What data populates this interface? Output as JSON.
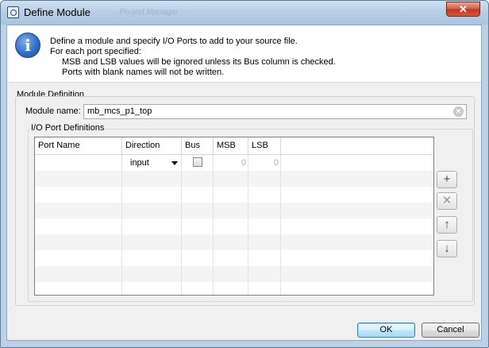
{
  "window": {
    "title": "Define Module",
    "background_title_ghost": "Project Manager",
    "close_glyph": "✕"
  },
  "header": {
    "icon": "info-icon",
    "line1": "Define a module and specify I/O Ports to add to your source file.",
    "line2": "For each port specified:",
    "line3": "MSB and LSB values will be ignored unless its Bus column is checked.",
    "line4": "Ports with blank names will not be written."
  },
  "module_definition": {
    "section_label": "Module Definition",
    "name_label": "Module name:",
    "name_value": "mb_mcs_p1_top"
  },
  "io_ports": {
    "label": "I/O Port Definitions",
    "columns": [
      "Port Name",
      "Direction",
      "Bus",
      "MSB",
      "LSB"
    ],
    "rows": [
      {
        "port_name": "",
        "direction": "input",
        "bus": false,
        "msb": "0",
        "lsb": "0"
      }
    ]
  },
  "side_buttons": [
    {
      "name": "add-port-button",
      "glyph": "+",
      "enabled": true
    },
    {
      "name": "remove-port-button",
      "glyph": "✕",
      "enabled": false
    },
    {
      "name": "move-up-button",
      "glyph": "↑",
      "enabled": true
    },
    {
      "name": "move-down-button",
      "glyph": "↓",
      "enabled": true
    }
  ],
  "footer": {
    "ok_label": "OK",
    "cancel_label": "Cancel"
  },
  "colors": {
    "titlebar": "#b9cfe8",
    "close_button": "#c2391f",
    "dialog_bg": "#f0f0f0",
    "ok_border": "#3c7fb1"
  }
}
